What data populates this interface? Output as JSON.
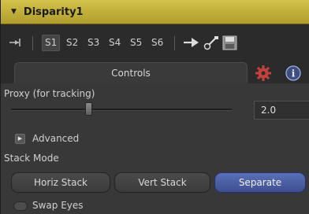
{
  "header": {
    "title": "Disparity1"
  },
  "toolbar": {
    "slots": [
      "S1",
      "S2",
      "S3",
      "S4",
      "S5",
      "S6"
    ]
  },
  "tabs": {
    "controls_label": "Controls"
  },
  "proxy": {
    "label": "Proxy (for tracking)",
    "value": "2.0",
    "slider_fraction": 0.35
  },
  "advanced": {
    "label": "Advanced"
  },
  "stack_mode": {
    "label": "Stack Mode",
    "options": [
      "Horiz Stack",
      "Vert Stack",
      "Separate"
    ],
    "selected": "Separate"
  },
  "swap_eyes": {
    "label": "Swap Eyes",
    "checked": false
  },
  "colors": {
    "header": "#c9b63f",
    "selected_button": "#4a5ca6",
    "gear": "#c7413c"
  }
}
